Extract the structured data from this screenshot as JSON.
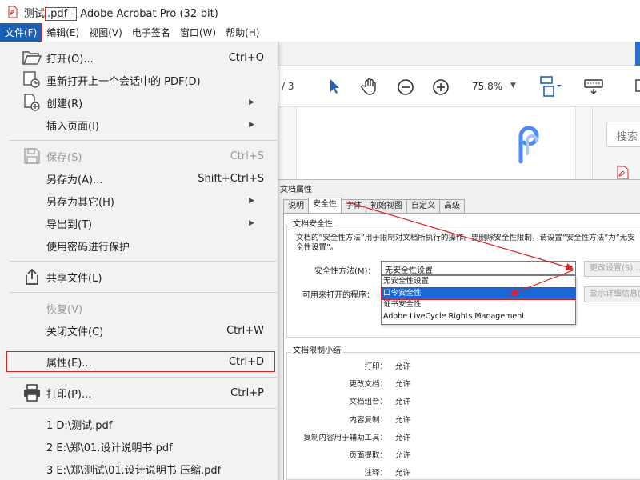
{
  "window": {
    "title_prefix": "测试",
    "title_highlight": ".pdf -",
    "title_suffix": " Adobe Acrobat Pro (32-bit)"
  },
  "menubar": {
    "items": [
      "文件(F)",
      "编辑(E)",
      "视图(V)",
      "电子签名",
      "窗口(W)",
      "帮助(H)"
    ]
  },
  "toolbar": {
    "page_count": "/ 3",
    "zoom": "75.8%"
  },
  "right_panel": {
    "search_placeholder": "搜索"
  },
  "file_menu": {
    "items": [
      {
        "label": "打开(O)...",
        "shortcut": "Ctrl+O",
        "icon": "folder-open-icon"
      },
      {
        "label": "重新打开上一个会话中的 PDF(D)",
        "icon": "reopen-session-icon"
      },
      {
        "label": "创建(R)",
        "icon": "create-pdf-icon",
        "submenu": true
      },
      {
        "label": "插入页面(I)",
        "submenu": true
      },
      {
        "label": "保存(S)",
        "shortcut": "Ctrl+S",
        "icon": "save-icon",
        "disabled": true
      },
      {
        "label": "另存为(A)...",
        "shortcut": "Shift+Ctrl+S"
      },
      {
        "label": "另存为其它(H)",
        "submenu": true
      },
      {
        "label": "导出到(T)",
        "submenu": true
      },
      {
        "label": "使用密码进行保护"
      },
      {
        "label": "共享文件(L)",
        "icon": "share-icon"
      },
      {
        "label": "恢复(V)",
        "disabled": true
      },
      {
        "label": "关闭文件(C)",
        "shortcut": "Ctrl+W"
      },
      {
        "label": "属性(E)...",
        "shortcut": "Ctrl+D"
      },
      {
        "label": "打印(P)...",
        "shortcut": "Ctrl+P",
        "icon": "printer-icon"
      },
      {
        "label": "1 D:\\测试.pdf"
      },
      {
        "label": "2 E:\\郑\\01.设计说明书.pdf"
      },
      {
        "label": "3 E:\\郑\\测试\\01.设计说明书 压缩.pdf"
      }
    ]
  },
  "dialog": {
    "title": "文档属性",
    "tabs": [
      "说明",
      "安全性",
      "字体",
      "初始视图",
      "自定义",
      "高级"
    ],
    "security_group_title": "文档安全性",
    "description": "文档的“安全性方法”用于限制对文档所执行的操作。要删除安全性限制，请设置“安全性方法”为“无安全性设置”。",
    "method_label": "安全性方法(M)：",
    "method_value": "无安全性设置",
    "change_button": "更改设置(S)...",
    "open_label": "可用来打开的程序：",
    "details_button": "显示详细信息(D)...",
    "method_options": [
      "无安全性设置",
      "口令安全性",
      "证书安全性",
      "Adobe LiveCycle Rights Management"
    ],
    "summary_title": "文档限制小结",
    "summary": [
      {
        "label": "打印：",
        "value": "允许"
      },
      {
        "label": "更改文档：",
        "value": "允许"
      },
      {
        "label": "文档组合：",
        "value": "允许"
      },
      {
        "label": "内容复制：",
        "value": "允许"
      },
      {
        "label": "复制内容用于辅助工具：",
        "value": "允许"
      },
      {
        "label": "页面提取：",
        "value": "允许"
      },
      {
        "label": "注释：",
        "value": "允许"
      }
    ]
  },
  "colors": {
    "accent": "#1a5fb4",
    "annotation_red": "#e02020",
    "menu_bg": "#f2f2f2",
    "toolbar_icon_blue": "#1f5fbf"
  }
}
